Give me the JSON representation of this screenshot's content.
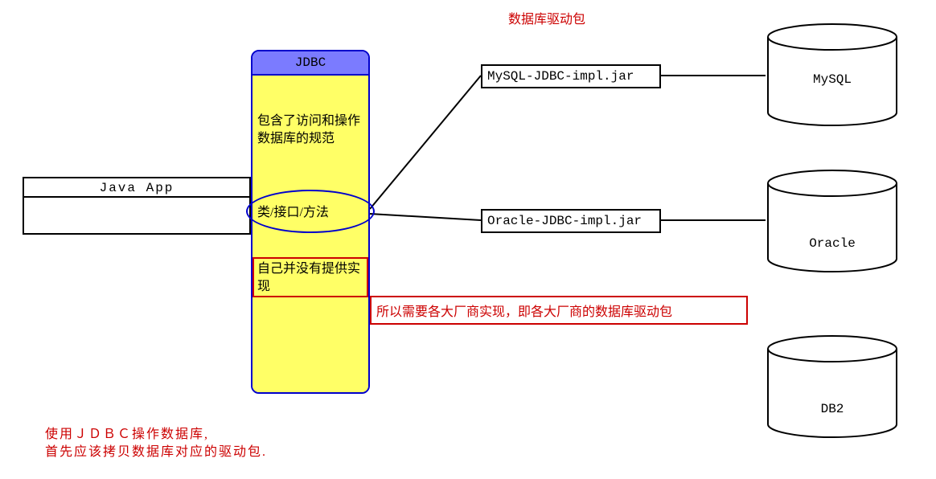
{
  "java_app_label": "Java   App",
  "jdbc": {
    "header": "JDBC",
    "desc": "包含了访问和操作数据库的规范",
    "interfaces": "类/接口/方法",
    "no_impl": "自己并没有提供实现"
  },
  "driver_title": "数据库驱动包",
  "impl": {
    "mysql": "MySQL-JDBC-impl.jar",
    "oracle": "Oracle-JDBC-impl.jar"
  },
  "db": {
    "mysql": "MySQL",
    "oracle": "Oracle",
    "db2": "DB2"
  },
  "red_annotation": "所以需要各大厂商实现，即各大厂商的数据库驱动包",
  "bottom_note": "使用ＪＤＢＣ操作数据库,\n首先应该拷贝数据库对应的驱动包."
}
